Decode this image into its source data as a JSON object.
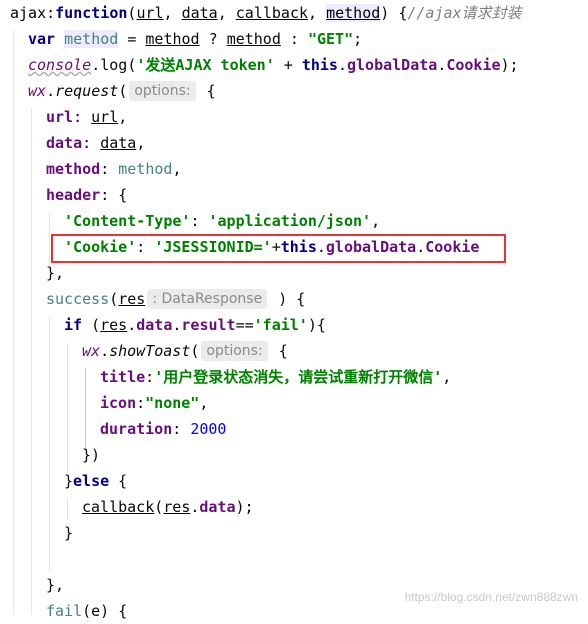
{
  "code": {
    "l1_name": "ajax",
    "l1_colon": ":",
    "l1_fn": "function",
    "l1_open": "(",
    "l1_p1": "url",
    "l1_c1": ", ",
    "l1_p2": "data",
    "l1_c2": ", ",
    "l1_p3": "callback",
    "l1_c3": ", ",
    "l1_p4": "method",
    "l1_close": ") {",
    "l1_comment": "//ajax请求封装",
    "l2_var": "var",
    "l2_name": "method",
    "l2_eq": " = ",
    "l2_ref1": "method",
    "l2_q": " ? ",
    "l2_ref2": "method",
    "l2_colon": " : ",
    "l2_str": "\"GET\"",
    "l2_end": ";",
    "l3_obj": "console",
    "l3_dot": ".",
    "l3_fn": "log",
    "l3_open": "(",
    "l3_str": "'发送AJAX token'",
    "l3_plus": " + ",
    "l3_this": "this",
    "l3_d1": ".",
    "l3_gd": "globalData",
    "l3_d2": ".",
    "l3_ck": "Cookie",
    "l3_end": ");",
    "l4_obj": "wx",
    "l4_dot": ".",
    "l4_fn": "request",
    "l4_open": "(",
    "l4_hint": "options:",
    "l4_brace": " {",
    "l5_key": "url",
    "l5_colon": ": ",
    "l5_val": "url",
    "l5_comma": ",",
    "l6_key": "data",
    "l6_colon": ": ",
    "l6_val": "data",
    "l6_comma": ",",
    "l7_key": "method",
    "l7_colon": ": ",
    "l7_val": "method",
    "l7_comma": ",",
    "l8_key": "header",
    "l8_rest": ": {",
    "l9_key": "'Content-Type'",
    "l9_colon": ": ",
    "l9_val": "'application/json'",
    "l9_comma": ",",
    "l10_key": "'Cookie'",
    "l10_colon": ": ",
    "l10_val": "'JSESSIONID='",
    "l10_plus": "+",
    "l10_this": "this",
    "l10_d1": ".",
    "l10_gd": "globalData",
    "l10_d2": ".",
    "l10_ck": "Cookie",
    "l11_text": "},",
    "l12_key": "success",
    "l12_open": "(",
    "l12_param": "res",
    "l12_hint": ": DataResponse",
    "l12_close": " ) {",
    "l13_if": "if",
    "l13_open": " (",
    "l13_res": "res",
    "l13_d1": ".",
    "l13_data": "data",
    "l13_d2": ".",
    "l13_result": "result",
    "l13_eq": "==",
    "l13_str": "'fail'",
    "l13_close": "){",
    "l14_obj": "wx",
    "l14_dot": ".",
    "l14_fn": "showToast",
    "l14_open": "(",
    "l14_hint": "options:",
    "l14_brace": " {",
    "l15_key": "title",
    "l15_colon": ":",
    "l15_val": "'用户登录状态消失，请尝试重新打开微信'",
    "l15_comma": ",",
    "l16_key": "icon",
    "l16_colon": ":",
    "l16_val": "\"none\"",
    "l16_comma": ",",
    "l17_key": "duration",
    "l17_colon": ": ",
    "l17_val": "2000",
    "l18_text": "})",
    "l19_close": "}",
    "l19_else": "else",
    "l19_brace": " {",
    "l20_fn": "callback",
    "l20_open": "(",
    "l20_res": "res",
    "l20_dot": ".",
    "l20_data": "data",
    "l20_end": ");",
    "l21_text": "}",
    "l23_text": "},",
    "l24_key": "fail",
    "l24_rest": "(e) {"
  },
  "watermark": "https://blog.csdn.net/zwn888zwn"
}
